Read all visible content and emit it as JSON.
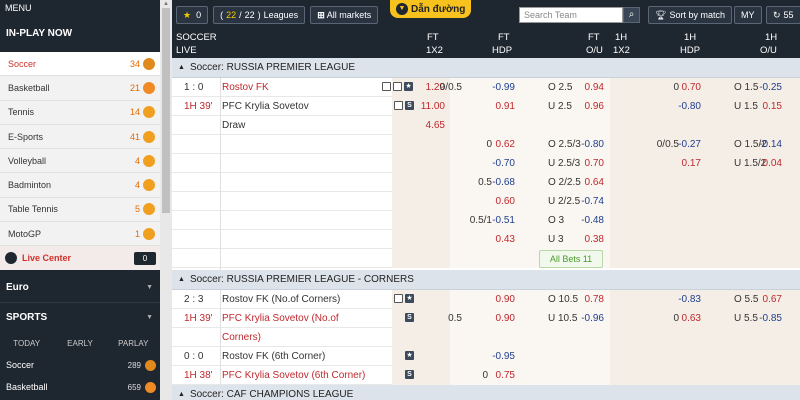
{
  "sidebar": {
    "menu_label": "MENU",
    "inplay_label": "IN-PLAY NOW",
    "sports": [
      {
        "name": "Soccer",
        "count": "34",
        "icon": "soccer-ball-icon",
        "color": "#e08a1e"
      },
      {
        "name": "Basketball",
        "count": "21",
        "icon": "basketball-icon",
        "color": "#f08a24"
      },
      {
        "name": "Tennis",
        "count": "14",
        "icon": "tennis-ball-icon",
        "color": "#f0a020"
      },
      {
        "name": "E-Sports",
        "count": "41",
        "icon": "e-sports-icon",
        "color": "#f0a020"
      },
      {
        "name": "Volleyball",
        "count": "4",
        "icon": "volleyball-icon",
        "color": "#f0a020"
      },
      {
        "name": "Badminton",
        "count": "4",
        "icon": "badminton-icon",
        "color": "#f0a020"
      },
      {
        "name": "Table Tennis",
        "count": "5",
        "icon": "table-tennis-icon",
        "color": "#f0a020"
      },
      {
        "name": "MotoGP",
        "count": "1",
        "icon": "motogp-icon",
        "color": "#f0a020"
      }
    ],
    "live_center": {
      "label": "Live Center",
      "count": "0"
    },
    "euro_label": "Euro",
    "sports_label": "SPORTS",
    "tabs": [
      "TODAY",
      "EARLY",
      "PARLAY"
    ],
    "sport_list": [
      {
        "name": "Soccer",
        "count": "289"
      },
      {
        "name": "Basketball",
        "count": "659"
      }
    ]
  },
  "toolbar": {
    "fav_count": "0",
    "leagues_current": "22",
    "leagues_total": "22",
    "leagues_label": "Leagues",
    "all_markets": "All markets",
    "dan_duong": "Dẫn đường",
    "search_placeholder": "Search Team",
    "sort_label": "Sort by match",
    "my_label": "MY",
    "c_label": "55"
  },
  "header": {
    "sport": "SOCCER",
    "live": "LIVE",
    "cols": [
      {
        "top": "FT",
        "bottom": "1X2"
      },
      {
        "top": "FT",
        "bottom": "HDP"
      },
      {
        "top": "FT",
        "bottom": "O/U"
      },
      {
        "top": "1H",
        "bottom": "1X2"
      },
      {
        "top": "1H",
        "bottom": "HDP"
      },
      {
        "top": "1H",
        "bottom": "O/U"
      }
    ]
  },
  "leagues": [
    {
      "name": "Soccer: RUSSIA PREMIER LEAGUE"
    },
    {
      "name": "Soccer: RUSSIA PREMIER LEAGUE - CORNERS"
    },
    {
      "name": "Soccer: CAF CHAMPIONS LEAGUE"
    }
  ],
  "match1": {
    "score": "1 : 0",
    "time": "1H 39'",
    "home": "Rostov FK",
    "away": "PFC Krylia Sovetov",
    "draw": "Draw",
    "x12": [
      "1.29",
      "11.00",
      "4.65"
    ],
    "all_bets": "All Bets 11",
    "rows": [
      {
        "ft_hdp_line": "0/0.5",
        "ft_hdp": "-0.99",
        "ft_ou_line": "O 2.5",
        "ft_ou": "0.94",
        "h1_hdp_line": "0",
        "h1_hdp": "0.70",
        "h1_ou_line": "O 1.5",
        "h1_ou": "-0.25"
      },
      {
        "ft_hdp_line": "",
        "ft_hdp": "0.91",
        "ft_ou_line": "U 2.5",
        "ft_ou": "0.96",
        "h1_hdp_line": "",
        "h1_hdp": "-0.80",
        "h1_ou_line": "U 1.5",
        "h1_ou": "0.15"
      },
      {
        "ft_hdp_line": "0",
        "ft_hdp": "0.62",
        "ft_ou_line": "O 2.5/3",
        "ft_ou": "-0.80",
        "h1_hdp_line": "0/0.5",
        "h1_hdp": "-0.27",
        "h1_ou_line": "O 1.5/2",
        "h1_ou": "-0.14"
      },
      {
        "ft_hdp_line": "",
        "ft_hdp": "-0.70",
        "ft_ou_line": "U 2.5/3",
        "ft_ou": "0.70",
        "h1_hdp_line": "",
        "h1_hdp": "0.17",
        "h1_ou_line": "U 1.5/2",
        "h1_ou": "0.04"
      },
      {
        "ft_hdp_line": "0.5",
        "ft_hdp": "-0.68",
        "ft_ou_line": "O 2/2.5",
        "ft_ou": "0.64",
        "h1_hdp_line": "",
        "h1_hdp": "",
        "h1_ou_line": "",
        "h1_ou": ""
      },
      {
        "ft_hdp_line": "",
        "ft_hdp": "0.60",
        "ft_ou_line": "U 2/2.5",
        "ft_ou": "-0.74",
        "h1_hdp_line": "",
        "h1_hdp": "",
        "h1_ou_line": "",
        "h1_ou": ""
      },
      {
        "ft_hdp_line": "0.5/1",
        "ft_hdp": "-0.51",
        "ft_ou_line": "O 3",
        "ft_ou": "-0.48",
        "h1_hdp_line": "",
        "h1_hdp": "",
        "h1_ou_line": "",
        "h1_ou": ""
      },
      {
        "ft_hdp_line": "",
        "ft_hdp": "0.43",
        "ft_ou_line": "U 3",
        "ft_ou": "0.38",
        "h1_hdp_line": "",
        "h1_hdp": "",
        "h1_ou_line": "",
        "h1_ou": ""
      }
    ]
  },
  "match2": {
    "score": "2 : 3",
    "time": "1H 39'",
    "home": "Rostov FK (No.of Corners)",
    "away_line1": "PFC Krylia Sovetov (No.of",
    "away_line2": "Corners)",
    "rows": [
      {
        "ft_hdp_line": "",
        "ft_hdp": "0.90",
        "ft_ou_line": "O 10.5",
        "ft_ou": "0.78",
        "h1_hdp_line": "",
        "h1_hdp": "-0.83",
        "h1_ou_line": "O 5.5",
        "h1_ou": "0.67"
      },
      {
        "ft_hdp_line": "0.5",
        "ft_hdp": "0.90",
        "ft_ou_line": "U 10.5",
        "ft_ou": "-0.96",
        "h1_hdp_line": "0",
        "h1_hdp": "0.63",
        "h1_ou_line": "U 5.5",
        "h1_ou": "-0.85"
      }
    ]
  },
  "match3": {
    "score": "0 : 0",
    "time": "1H 38'",
    "home": "Rostov FK (6th Corner)",
    "away": "PFC Krylia Sovetov (6th Corner)",
    "rows": [
      {
        "ft_hdp_line": "",
        "ft_hdp": "-0.95"
      },
      {
        "ft_hdp_line": "0",
        "ft_hdp": "0.75"
      }
    ]
  }
}
